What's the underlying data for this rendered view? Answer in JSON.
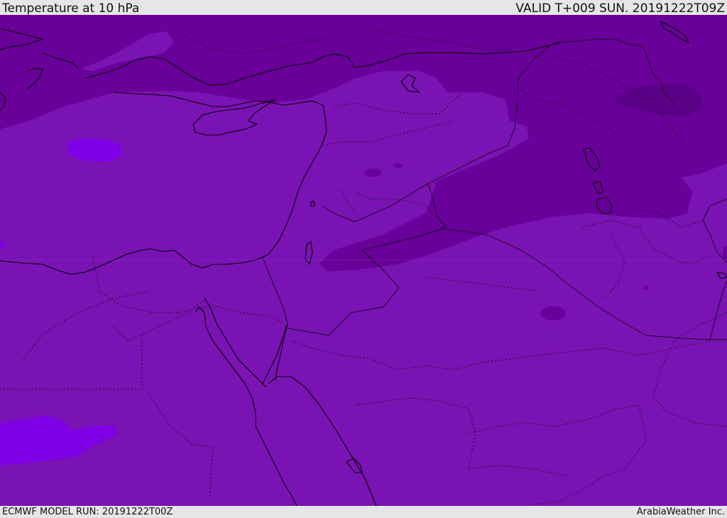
{
  "header": {
    "title": "Temperature at 10 hPa",
    "valid_time": "VALID T+009 SUN. 20191222T09Z"
  },
  "footer": {
    "model_run": "ECMWF MODEL RUN: 20191222T00Z",
    "credit": "ArabiaWeather Inc."
  },
  "map": {
    "colors": {
      "base_fill": "#7a13b3",
      "cold_band": "#680099",
      "colder_core": "#5a0086",
      "warm_patch": "#7f00e6",
      "warm_patch_alt": "#8a0ad8",
      "coastline": "#000000",
      "border": "#1a0a2a"
    }
  }
}
